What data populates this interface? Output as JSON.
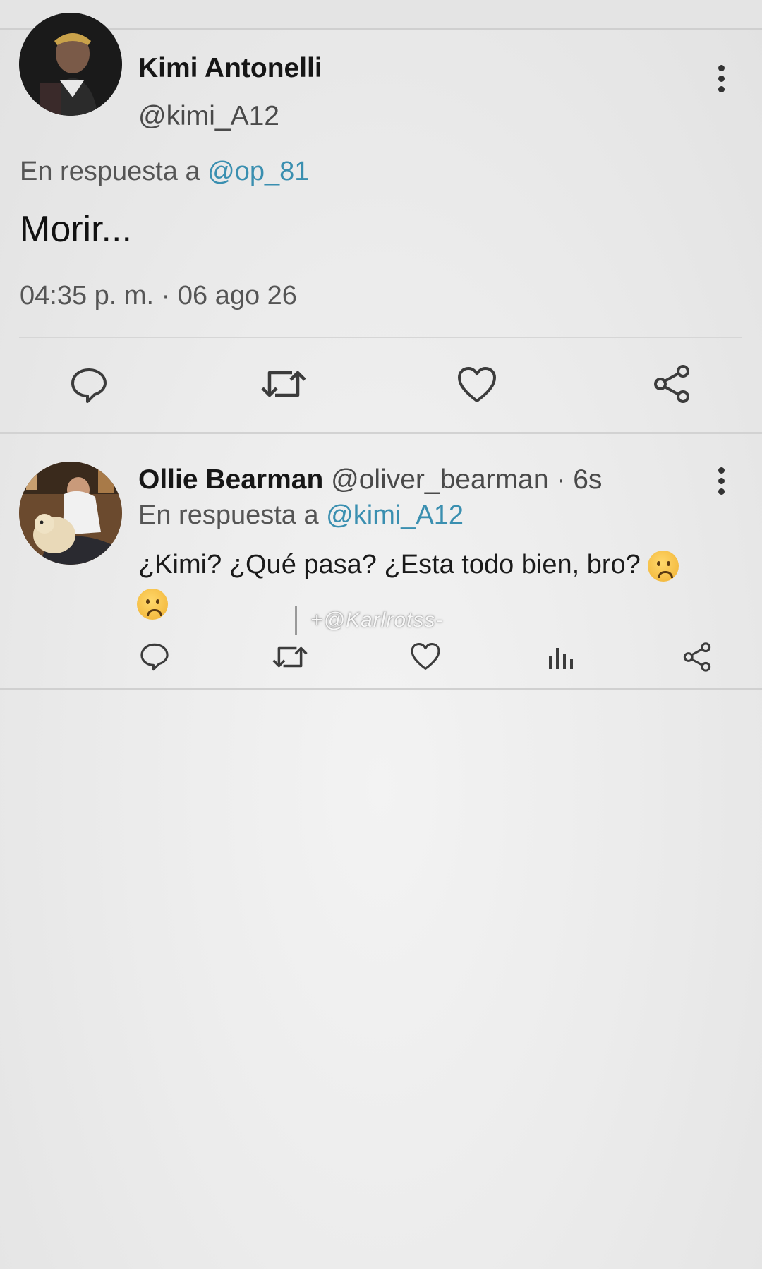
{
  "main_tweet": {
    "author_name": "Kimi Antonelli",
    "author_handle": "@kimi_A12",
    "reply_prefix": "En respuesta a",
    "reply_mention": "@op_81",
    "text": "Morir...",
    "timestamp": "04:35 p. m. · 06 ago 26"
  },
  "reply_tweet": {
    "author_name": "Ollie Bearman",
    "author_handle": "@oliver_bearman",
    "time_ago": "· 6s",
    "reply_prefix": "En respuesta a",
    "reply_mention": "@kimi_A12",
    "text": "¿Kimi? ¿Qué pasa? ¿Esta todo bien, bro?"
  },
  "watermark": "+@Karlrotss-",
  "icons": {
    "reply": "comment-icon",
    "retweet": "retweet-icon",
    "like": "heart-icon",
    "stats": "stats-icon",
    "share": "share-icon",
    "more": "more-vertical-icon",
    "emoji": "worried-face-emoji"
  },
  "colors": {
    "mention": "#3a8fb0",
    "background": "#ececec"
  }
}
